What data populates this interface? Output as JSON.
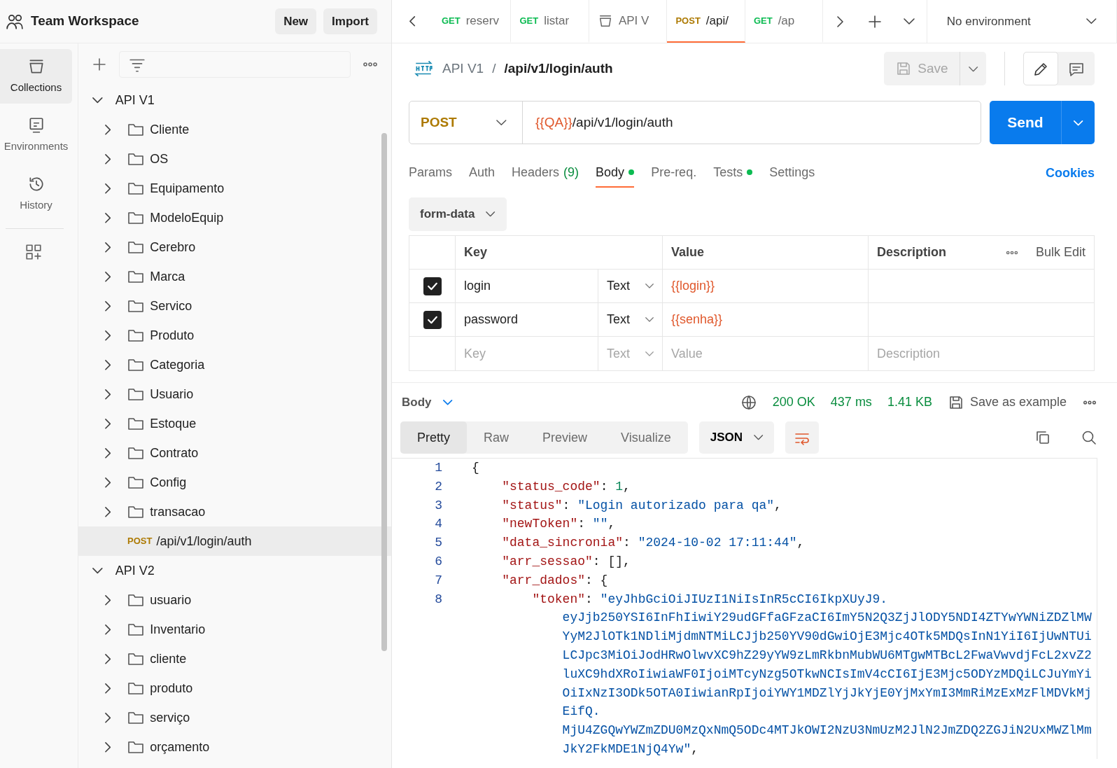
{
  "workspace": {
    "title": "Team Workspace",
    "buttons": [
      "New",
      "Import"
    ]
  },
  "rail": [
    {
      "kind": "collections",
      "label": "Collections",
      "selected": true
    },
    {
      "kind": "environments",
      "label": "Environments",
      "selected": false
    },
    {
      "kind": "history",
      "label": "History",
      "selected": false
    }
  ],
  "tree": [
    {
      "kind": "collection",
      "label": "API V1",
      "expanded": true,
      "selected": false,
      "children": [
        {
          "kind": "folder",
          "label": "Cliente",
          "expanded": false,
          "selected": false
        },
        {
          "kind": "folder",
          "label": "OS",
          "expanded": false,
          "selected": false
        },
        {
          "kind": "folder",
          "label": "Equipamento",
          "expanded": false,
          "selected": false
        },
        {
          "kind": "folder",
          "label": "ModeloEquip",
          "expanded": false,
          "selected": false
        },
        {
          "kind": "folder",
          "label": "Cerebro",
          "expanded": false,
          "selected": false
        },
        {
          "kind": "folder",
          "label": "Marca",
          "expanded": false,
          "selected": false
        },
        {
          "kind": "folder",
          "label": "Servico",
          "expanded": false,
          "selected": false
        },
        {
          "kind": "folder",
          "label": "Produto",
          "expanded": false,
          "selected": false
        },
        {
          "kind": "folder",
          "label": "Categoria",
          "expanded": false,
          "selected": false
        },
        {
          "kind": "folder",
          "label": "Usuario",
          "expanded": false,
          "selected": false
        },
        {
          "kind": "folder",
          "label": "Estoque",
          "expanded": false,
          "selected": false
        },
        {
          "kind": "folder",
          "label": "Contrato",
          "expanded": false,
          "selected": false
        },
        {
          "kind": "folder",
          "label": "Config",
          "expanded": false,
          "selected": false
        },
        {
          "kind": "folder",
          "label": "transacao",
          "expanded": false,
          "selected": false
        },
        {
          "kind": "request",
          "method": "POST",
          "label": "/api/v1/login/auth",
          "selected": true
        }
      ]
    },
    {
      "kind": "collection",
      "label": "API V2",
      "expanded": true,
      "selected": false,
      "children": [
        {
          "kind": "folder",
          "label": "usuario",
          "expanded": false,
          "selected": false
        },
        {
          "kind": "folder",
          "label": "Inventario",
          "expanded": false,
          "selected": false
        },
        {
          "kind": "folder",
          "label": "cliente",
          "expanded": false,
          "selected": false
        },
        {
          "kind": "folder",
          "label": "produto",
          "expanded": false,
          "selected": false
        },
        {
          "kind": "folder",
          "label": "serviço",
          "expanded": false,
          "selected": false
        },
        {
          "kind": "folder",
          "label": "orçamento",
          "expanded": false,
          "selected": false
        }
      ]
    }
  ],
  "tabs": [
    {
      "kind": "request",
      "method": "GET",
      "label": "reserv",
      "selected": false
    },
    {
      "kind": "request",
      "method": "GET",
      "label": "listar",
      "selected": false
    },
    {
      "kind": "collection",
      "label": "API V",
      "selected": false
    },
    {
      "kind": "request",
      "method": "POST",
      "label": "/api/",
      "selected": true
    },
    {
      "kind": "request",
      "method": "GET",
      "label": "/ap",
      "selected": false
    }
  ],
  "environment": "No environment",
  "breadcrumb": {
    "collection": "API V1",
    "separator": "/",
    "request": "/api/v1/login/auth"
  },
  "save_button": "Save",
  "request": {
    "method": "POST",
    "url": [
      {
        "kind": "variable",
        "text": "{{QA}}"
      },
      {
        "kind": "plain",
        "text": "/api/v1/login/auth"
      }
    ],
    "send": "Send"
  },
  "request_tabs": [
    {
      "label": "Params",
      "selected": false,
      "dot": false
    },
    {
      "label": "Auth",
      "selected": false,
      "dot": false
    },
    {
      "label": "Headers",
      "count": "(9)",
      "selected": false,
      "dot": false
    },
    {
      "label": "Body",
      "selected": true,
      "dot": true
    },
    {
      "label": "Pre-req.",
      "selected": false,
      "dot": false
    },
    {
      "label": "Tests",
      "selected": false,
      "dot": true
    },
    {
      "label": "Settings",
      "selected": false,
      "dot": false
    }
  ],
  "cookies": "Cookies",
  "body_mode": "form-data",
  "params_table": {
    "columns": [
      "Key",
      "Value",
      "Description"
    ],
    "bulk_edit": "Bulk Edit",
    "rows": [
      {
        "checked": true,
        "key": "login",
        "type": "Text",
        "value": "{{login}}"
      },
      {
        "checked": true,
        "key": "password",
        "type": "Text",
        "value": "{{senha}}"
      }
    ],
    "new_row": {
      "key": "Key",
      "type": "Text",
      "value": "Value",
      "description": "Description"
    }
  },
  "response": {
    "label": "Body",
    "status": "200 OK",
    "time": "437 ms",
    "size": "1.41 KB",
    "save_example": "Save as example",
    "views": [
      {
        "label": "Pretty",
        "selected": true
      },
      {
        "label": "Raw",
        "selected": false
      },
      {
        "label": "Preview",
        "selected": false
      },
      {
        "label": "Visualize",
        "selected": false
      }
    ],
    "format": "JSON",
    "lines": [
      {
        "n": "1",
        "parts": [
          {
            "kind": "punct",
            "t": "{"
          }
        ],
        "children": [
          {
            "n": "2",
            "parts": [
              {
                "kind": "key",
                "t": "\"status_code\""
              },
              {
                "kind": "punct",
                "t": ": "
              },
              {
                "kind": "num",
                "t": "1"
              },
              {
                "kind": "punct",
                "t": ","
              }
            ]
          },
          {
            "n": "3",
            "parts": [
              {
                "kind": "key",
                "t": "\"status\""
              },
              {
                "kind": "punct",
                "t": ": "
              },
              {
                "kind": "str",
                "t": "\"Login autorizado para qa\""
              },
              {
                "kind": "punct",
                "t": ","
              }
            ]
          },
          {
            "n": "4",
            "parts": [
              {
                "kind": "key",
                "t": "\"newToken\""
              },
              {
                "kind": "punct",
                "t": ": "
              },
              {
                "kind": "str",
                "t": "\"\""
              },
              {
                "kind": "punct",
                "t": ","
              }
            ]
          },
          {
            "n": "5",
            "parts": [
              {
                "kind": "key",
                "t": "\"data_sincronia\""
              },
              {
                "kind": "punct",
                "t": ": "
              },
              {
                "kind": "str",
                "t": "\"2024-10-02 17:11:44\""
              },
              {
                "kind": "punct",
                "t": ","
              }
            ]
          },
          {
            "n": "6",
            "parts": [
              {
                "kind": "key",
                "t": "\"arr_sessao\""
              },
              {
                "kind": "punct",
                "t": ": [],"
              }
            ]
          },
          {
            "n": "7",
            "parts": [
              {
                "kind": "key",
                "t": "\"arr_dados\""
              },
              {
                "kind": "punct",
                "t": ": {"
              }
            ],
            "children": [
              {
                "n": "8",
                "parts": [
                  {
                    "kind": "key",
                    "t": "\"token\""
                  },
                  {
                    "kind": "punct",
                    "t": ": "
                  },
                  {
                    "kind": "str",
                    "t": "\"eyJhbGciOiJIUzI1NiIsInR5cCI6IkpXUyJ9."
                  }
                ],
                "wrap": [
                  [
                    {
                      "kind": "str",
                      "t": "eyJjb250YSI6InFhIiwiY29udGFfaGFzaCI6ImY5N2Q3ZjJlODY5NDI4ZTYwYWNiZDZlMW"
                    }
                  ],
                  [
                    {
                      "kind": "str",
                      "t": "YyM2JlOTk1NDliMjdmNTMiLCJjb250YV90dGwiOjE3Mjc4OTk5MDQsInN1YiI6IjUwNTUi"
                    }
                  ],
                  [
                    {
                      "kind": "str",
                      "t": "LCJpc3MiOiJodHRwOlwvXC9hZ29yYW9zLmRkbnMubWU6MTgwMTBcL2FwaVwvdjFcL2xvZ2"
                    }
                  ],
                  [
                    {
                      "kind": "str",
                      "t": "luXC9hdXRoIiwiaWF0IjoiMTcyNzg5OTkwNCIsImV4cCI6IjE3Mjc5ODYzMDQiLCJuYmYi"
                    }
                  ],
                  [
                    {
                      "kind": "str",
                      "t": "OiIxNzI3ODk5OTA0IiwianRpIjoiYWY1MDZlYjJkYjE0YjMxYmI3MmRiMzExMzFlMDVkMj"
                    }
                  ],
                  [
                    {
                      "kind": "str",
                      "t": "EifQ."
                    }
                  ],
                  [
                    {
                      "kind": "str",
                      "t": "MjU4ZGQwYWZmZDU0MzQxNmQ5ODc4MTJkOWI2NzU3NmUzM2JlN2JmZDQ2ZGJiN2UxMWZlMm"
                    }
                  ],
                  [
                    {
                      "kind": "str",
                      "t": "JkY2FkMDE1NjQ4Yw\""
                    },
                    {
                      "kind": "punct",
                      "t": ","
                    }
                  ]
                ]
              }
            ]
          }
        ]
      }
    ]
  }
}
